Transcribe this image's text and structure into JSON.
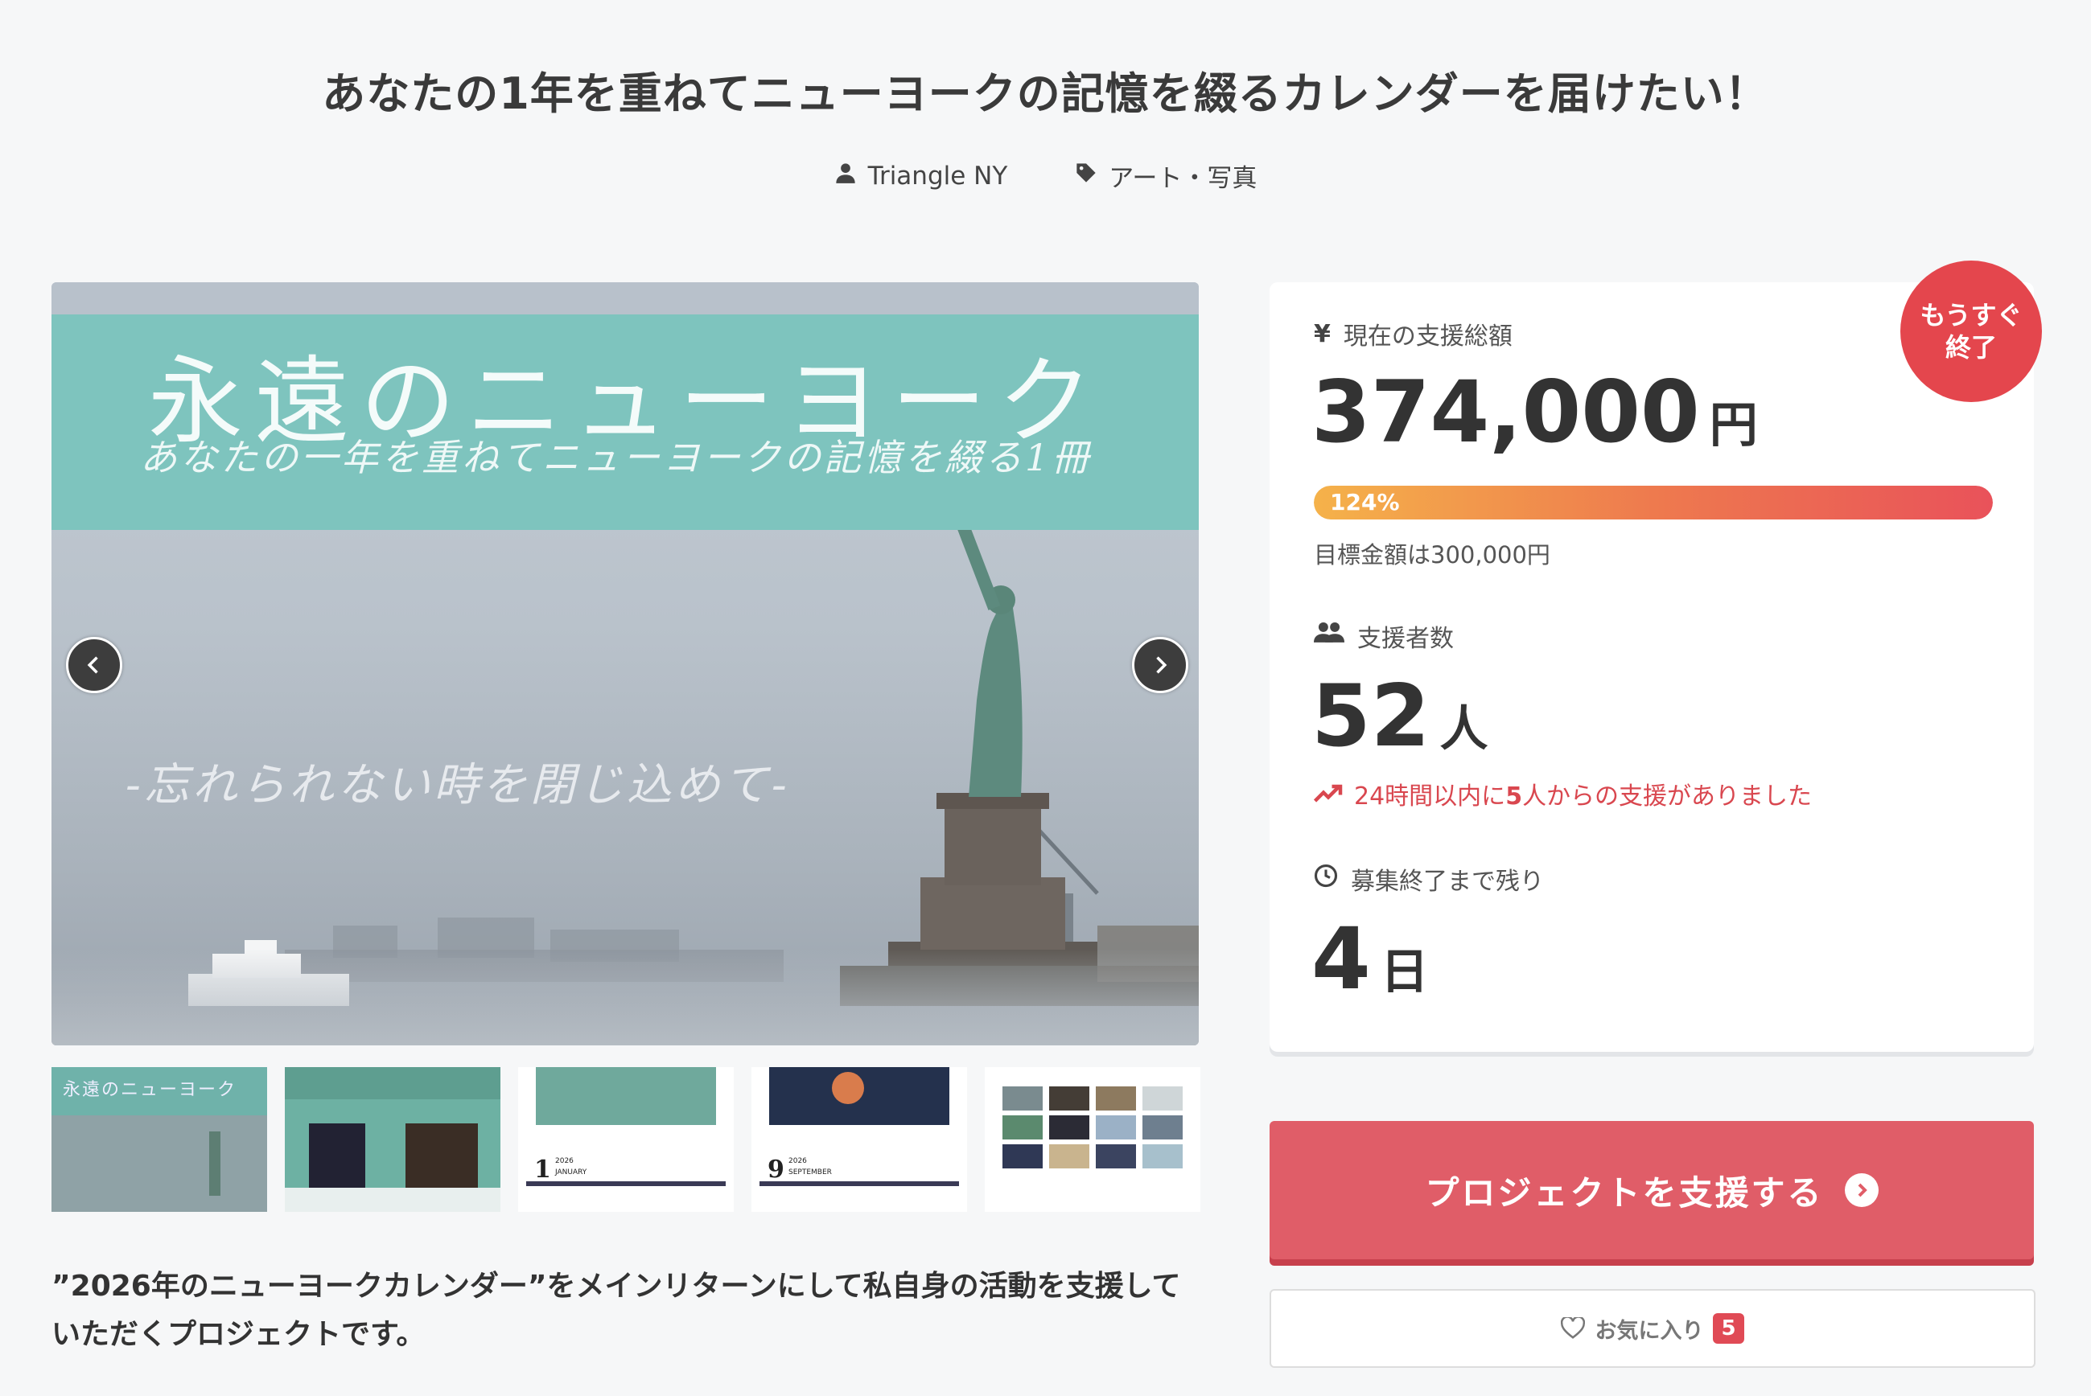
{
  "project": {
    "title": "あなたの1年を重ねてニューヨークの記憶を綴るカレンダーを届けたい！",
    "owner": "Triangle NY",
    "category": "アート・写真"
  },
  "hero": {
    "band_title": "永遠のニューヨーク",
    "band_subtitle": "あなたの一年を重ねてニューヨークの記憶を綴る1冊",
    "tagline": "-忘れられない時を閉じ込めて-"
  },
  "thumbnails": [
    {
      "name": "thumb-cover",
      "caption": "永遠のニューヨーク"
    },
    {
      "name": "thumb-storefront",
      "caption": ""
    },
    {
      "name": "thumb-january",
      "month_num": "1",
      "month": "JANUARY",
      "year": "2026"
    },
    {
      "name": "thumb-september",
      "month_num": "9",
      "month": "SEPTEMBER",
      "year": "2026"
    },
    {
      "name": "thumb-grid",
      "caption": ""
    }
  ],
  "description": "”2026年のニューヨークカレンダー”をメインリターンにして私自身の活動を支援していただくプロジェクトです。",
  "stats": {
    "total_label": "現在の支援総額",
    "total_amount": "374,000",
    "total_unit": "円",
    "progress_percent": 124,
    "progress_text": "124%",
    "goal_text": "目標金額は300,000円",
    "backers_label": "支援者数",
    "backers_count": "52",
    "backers_unit": "人",
    "recent_prefix": "24時間以内に",
    "recent_count": "5",
    "recent_suffix": "人からの支援がありました",
    "remaining_label": "募集終了まで残り",
    "remaining_count": "4",
    "remaining_unit": "日"
  },
  "badge": {
    "line1": "もうすぐ",
    "line2": "終了"
  },
  "actions": {
    "support_label": "プロジェクトを支援する",
    "favorite_label": "お気に入り",
    "favorite_count": "5"
  },
  "colors": {
    "accent": "#e05d68",
    "badge": "#e4464d",
    "band": "#7ec4be",
    "recent": "#d9474f"
  }
}
